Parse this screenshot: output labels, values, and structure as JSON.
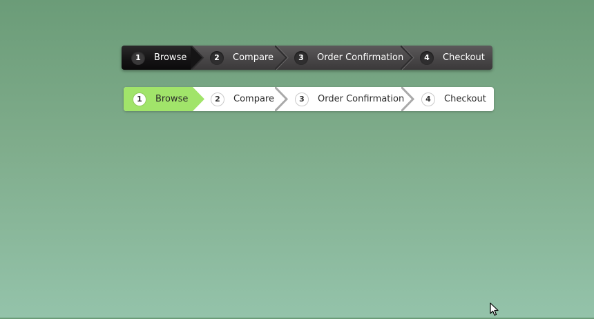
{
  "steppers": [
    {
      "theme": "dark",
      "active_index": 0,
      "colors": {
        "background": "#4a4849",
        "active": "#151415",
        "text": "#ffffff",
        "badge": "#2f2e2f"
      },
      "steps": [
        {
          "number": "1",
          "label": "Browse"
        },
        {
          "number": "2",
          "label": "Compare"
        },
        {
          "number": "3",
          "label": "Order Confirmation"
        },
        {
          "number": "4",
          "label": "Checkout"
        }
      ]
    },
    {
      "theme": "light",
      "active_index": 0,
      "colors": {
        "background": "#ffffff",
        "active": "#a1e46a",
        "text": "#2a2a2a",
        "badge_border": "#c9c9c9"
      },
      "steps": [
        {
          "number": "1",
          "label": "Browse"
        },
        {
          "number": "2",
          "label": "Compare"
        },
        {
          "number": "3",
          "label": "Order Confirmation"
        },
        {
          "number": "4",
          "label": "Checkout"
        }
      ]
    }
  ],
  "page": {
    "background_top": "#6b9c78",
    "background_bottom": "#94c3aa"
  },
  "cursor": {
    "icon": "arrow-cursor-icon"
  }
}
